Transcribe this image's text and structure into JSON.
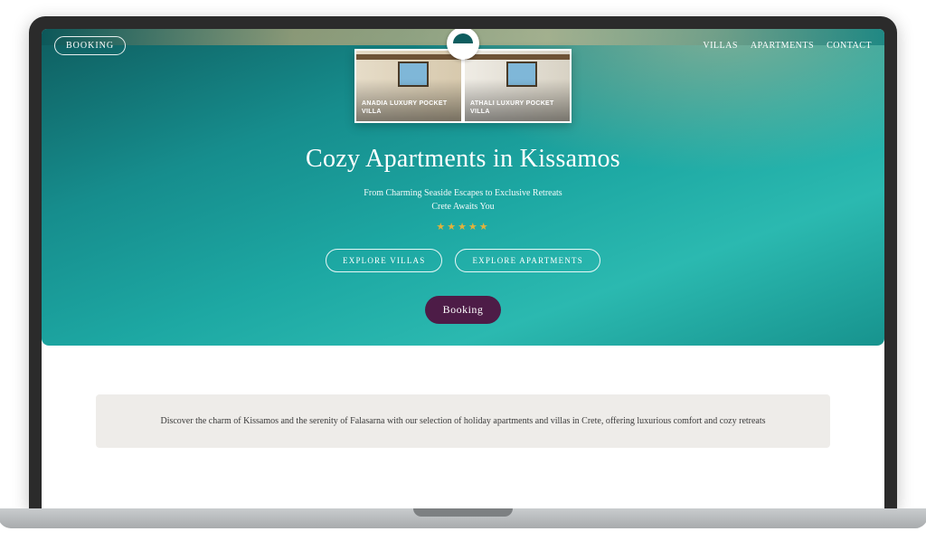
{
  "topbar": {
    "booking_label": "BOOKING",
    "nav": {
      "villas": "VILLAS",
      "apartments": "APARTMENTS",
      "contact": "CONTACT"
    }
  },
  "dropdown": {
    "cards": [
      {
        "label": "ANADIA LUXURY POCKET VILLA"
      },
      {
        "label": "ATHALI LUXURY POCKET VILLA"
      }
    ]
  },
  "hero": {
    "title": "Cozy Apartments in Kissamos",
    "sub_line1": "From Charming Seaside Escapes to Exclusive Retreats",
    "sub_line2": "Crete Awaits You",
    "stars": "★★★★★",
    "cta_villas": "EXPLORE VILLAS",
    "cta_apartments": "EXPLORE APARTMENTS",
    "booking_button": "Booking"
  },
  "intro": {
    "text": "Discover the charm of Kissamos and the serenity of Falasarna with our selection of holiday apartments and villas in Crete, offering luxurious comfort and cozy retreats"
  },
  "colors": {
    "accent_dark_purple": "#4d1c47",
    "hero_teal": "#168d8d",
    "star_gold": "#e2b23c"
  }
}
